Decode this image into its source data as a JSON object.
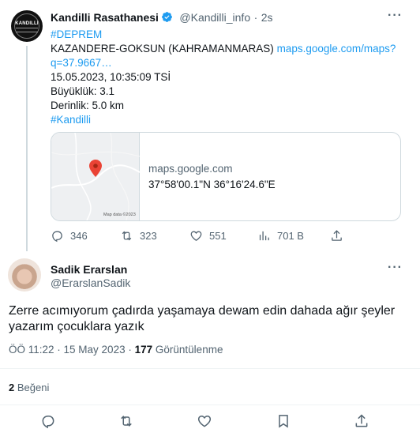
{
  "tweet": {
    "author_name": "Kandilli Rasathanesi",
    "handle": "@Kandilli_info",
    "separator": "·",
    "time": "2s",
    "avatar_text": "KANDILLI",
    "lines": {
      "hashtag1": "#DEPREM",
      "location": "KAZANDERE-GOKSUN (KAHRAMANMARAS)",
      "link_part1": "maps.google.com/maps?",
      "link_part2": "q=37.9667…",
      "datetime": "15.05.2023, 10:35:09 TSİ",
      "magnitude": "Büyüklük: 3.1",
      "depth": "Derinlik: 5.0 km",
      "hashtag2": "#Kandilli"
    },
    "card": {
      "domain": "maps.google.com",
      "coords": "37°58'00.1\"N 36°16'24.6\"E",
      "map_data_label": "Map data ©2023"
    },
    "actions": {
      "replies": "346",
      "retweets": "323",
      "likes": "551",
      "views": "701 B"
    }
  },
  "reply": {
    "author_name": "Sadik Erarslan",
    "handle": "@ErarslanSadik",
    "text_line1": "Zerre acımıyorum çadırda yaşamaya dewam edin dahada ağır şeyler",
    "text_line2": "yazarım çocuklara yazık",
    "meta_time": "ÖÖ 11:22 · 15 May 2023 ·",
    "meta_views_count": "177",
    "meta_views_label": "Görüntülenme",
    "likes_count": "2",
    "likes_label": "Beğeni"
  },
  "colors": {
    "accent": "#1d9bf0",
    "text": "#0f1419",
    "muted": "#536471",
    "divider": "#eff3f4",
    "map_pin": "#ea4335"
  },
  "icons": [
    "verified-badge-icon",
    "more-icon",
    "map-pin-icon",
    "reply-icon",
    "retweet-icon",
    "like-icon",
    "views-icon",
    "share-icon",
    "bookmark-icon"
  ]
}
